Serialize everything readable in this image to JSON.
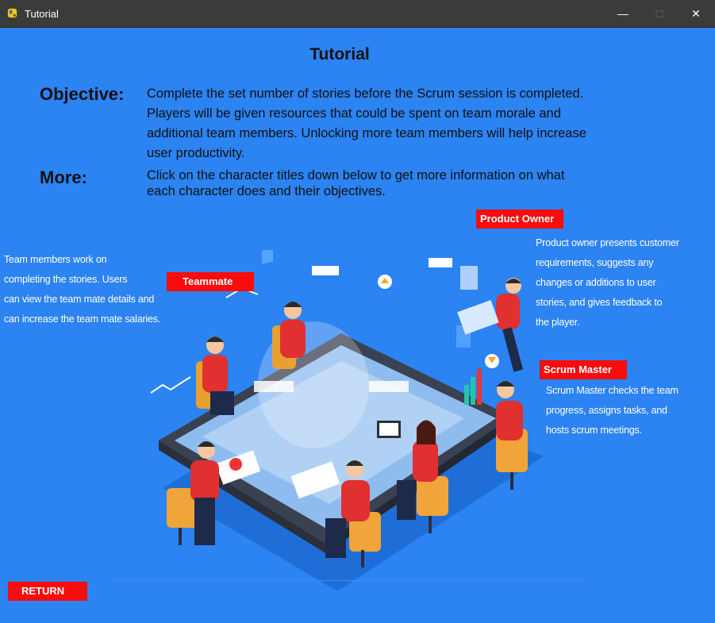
{
  "window": {
    "title": "Tutorial",
    "minimize": "—",
    "maximize": "□",
    "close": "✕",
    "app_icon": "python-icon"
  },
  "page": {
    "heading": "Tutorial",
    "objective_label": "Objective:",
    "objective_lines": [
      "Complete the set number of stories before the Scrum session is completed.",
      "Players will be given resources that could be spent on team morale and",
      "additional team members. Unlocking more team members will help increase",
      "user productivity."
    ],
    "more_label": "More:",
    "more_lines": [
      "Click on the character titles down below to get more information on what",
      "each character does and their objectives."
    ]
  },
  "characters": {
    "teammate": {
      "button": "Teammate",
      "lines": [
        "Team members work on",
        "completing the stories. Users",
        "can view the team mate details and",
        "can increase the team mate salaries."
      ]
    },
    "product_owner": {
      "button": "Product Owner",
      "lines": [
        "Product owner presents customer",
        "requirements, suggests any",
        "changes or additions to user",
        "stories, and gives feedback to",
        "the player."
      ]
    },
    "scrum_master": {
      "button": "Scrum Master",
      "lines": [
        "Scrum Master checks the team",
        "progress, assigns tasks, and",
        "hosts scrum meetings."
      ]
    }
  },
  "return_button": "RETURN",
  "colors": {
    "background": "#2c83f2",
    "button": "#f70d0d",
    "titlebar": "#3b3b3b"
  }
}
